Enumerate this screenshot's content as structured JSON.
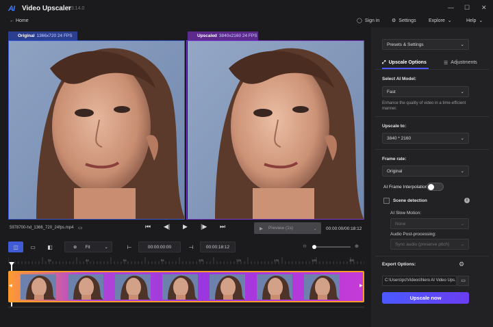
{
  "app": {
    "logo": "AI",
    "title": "Video Upscaler",
    "version": "1.3.14.0",
    "home": "Home"
  },
  "header": {
    "signin": "Sign in",
    "settings": "Settings",
    "explore": "Explore",
    "help": "Help"
  },
  "window_controls": {
    "minimize": "—",
    "maximize": "☐",
    "close": "✕"
  },
  "panes": {
    "original": {
      "label": "Original",
      "meta": "1366x720 24 FPS"
    },
    "upscaled": {
      "label": "Upscaled",
      "meta": "3840x2160 24 FPS"
    }
  },
  "player": {
    "filename": "5978700-hd_1366_720_24fps.mp4",
    "preview": "Preview (1s)",
    "time": "00:00:00/00:18:12"
  },
  "timeline_tools": {
    "fit": "Fit",
    "start": "00:00:00:00",
    "end": "00:00:18:12"
  },
  "ruler_labels": [
    "2s",
    "4s",
    "6s",
    "8s",
    "10s",
    "12s",
    "14s",
    "16s",
    "18s"
  ],
  "thumb_count": 7,
  "colors": {
    "accent": "#4b59ff",
    "original_tag": "#2c3e8f",
    "upscaled_tag": "#5b2a8c",
    "strip_border": "#f79c2a"
  },
  "right_panel": {
    "presets": "Presets & Settings",
    "tabs": {
      "upscale": "Upscale Options",
      "adjust": "Adjustments"
    },
    "model": {
      "label": "Select AI Model:",
      "value": "Fast",
      "desc": "Enhance the quality of video in a time-efficient manner."
    },
    "upscale_to": {
      "label": "Upscale to:",
      "value": "3840 * 2160"
    },
    "frame_rate": {
      "label": "Frame rate:",
      "value": "Original"
    },
    "interp": {
      "label": "AI Frame Interpolation"
    },
    "scene": {
      "label": "Scene detection"
    },
    "slow": {
      "label": "AI Slow Motion:",
      "value": "None"
    },
    "audio": {
      "label": "Audio Post-processing:",
      "value": "Sync audio (preserve pitch)"
    },
    "export": {
      "label": "Export Options:",
      "path": "C:\\Users\\pc\\Videos\\Nero AI Video Ups..."
    },
    "action": "Upscale now"
  }
}
